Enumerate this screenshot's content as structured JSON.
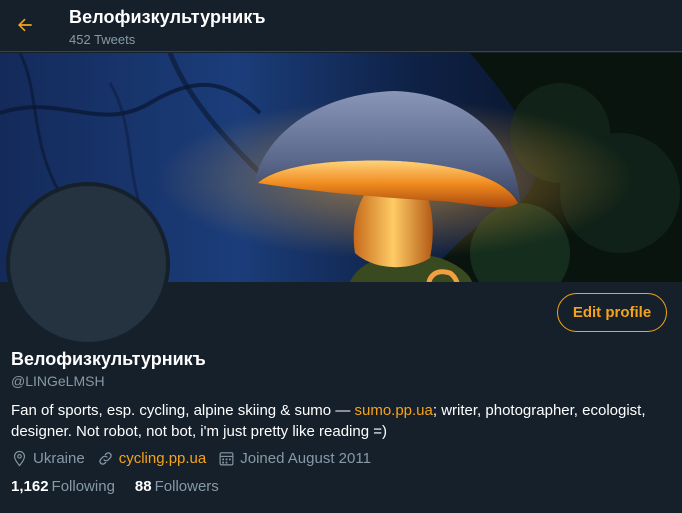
{
  "header": {
    "title": "Велофизкультурникъ",
    "tweet_count": "452 Tweets"
  },
  "profile": {
    "display_name": "Велофизкультурникъ",
    "handle": "@LINGeLMSH",
    "edit_label": "Edit profile",
    "bio": {
      "before": "Fan of sports, esp. cycling, alpine skiing & sumo — ",
      "link": "sumo.pp.ua",
      "after": "; writer, photographer, ecologist, designer. Not robot, not bot, i'm just pretty like reading =)"
    },
    "location": "Ukraine",
    "website": "cycling.pp.ua",
    "joined": "Joined August 2011",
    "following_count": "1,162",
    "following_label": "Following",
    "followers_count": "88",
    "followers_label": "Followers"
  },
  "icons": {
    "back": "arrow-left-icon",
    "location": "location-pin-icon",
    "link": "link-icon",
    "calendar": "calendar-icon"
  },
  "colors": {
    "background": "#15202b",
    "accent": "#f5a31a",
    "secondary_text": "#8899a6",
    "avatar_placeholder": "#253341"
  }
}
